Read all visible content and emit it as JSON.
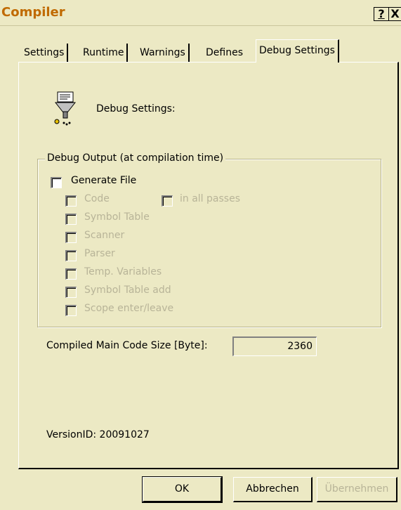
{
  "window": {
    "title": "Compiler",
    "help_button": "?",
    "close_button": "X"
  },
  "tabs": [
    {
      "label": "Settings"
    },
    {
      "label": "Runtime"
    },
    {
      "label": "Warnings"
    },
    {
      "label": "Defines"
    },
    {
      "label": "Debug Settings",
      "active": true
    }
  ],
  "heading": {
    "icon": "debug-funnel-icon",
    "label": "Debug Settings:"
  },
  "debug_output": {
    "group_label": "Debug Output (at compilation time)",
    "generate_file": {
      "label": "Generate File",
      "checked": false,
      "enabled": true
    },
    "options": [
      {
        "label": "Code",
        "checked": false,
        "enabled": false
      },
      {
        "label": "in all passes",
        "checked": false,
        "enabled": false
      },
      {
        "label": "Symbol Table",
        "checked": false,
        "enabled": false
      },
      {
        "label": "Scanner",
        "checked": false,
        "enabled": false
      },
      {
        "label": "Parser",
        "checked": false,
        "enabled": false
      },
      {
        "label": "Temp. Variables",
        "checked": false,
        "enabled": false
      },
      {
        "label": "Symbol Table add",
        "checked": false,
        "enabled": false
      },
      {
        "label": "Scope enter/leave",
        "checked": false,
        "enabled": false
      }
    ]
  },
  "code_size": {
    "label": "Compiled Main Code Size [Byte]:",
    "value": "2360"
  },
  "version": "VersionID: 20091027",
  "buttons": {
    "ok": "OK",
    "cancel": "Abbrechen",
    "apply": "Übernehmen"
  },
  "colors": {
    "background": "#ece9c4",
    "title": "#c06a00",
    "disabled_text": "#b8b498"
  }
}
